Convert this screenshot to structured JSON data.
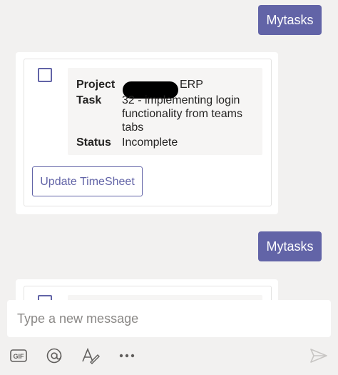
{
  "messages": [
    {
      "bubble": "Mytasks"
    },
    {
      "bubble": "Mytasks"
    }
  ],
  "card": {
    "project_label": "Project",
    "project_value": "ERP",
    "task_label": "Task",
    "task_value": "32 - implementing login functionality from teams tabs",
    "status_label": "Status",
    "status_value": "Incomplete",
    "button_label": "Update TimeSheet"
  },
  "composer": {
    "placeholder": "Type a new message"
  },
  "toolbar": {
    "gif_label": "GIF",
    "icons": [
      "gif-icon",
      "mention-icon",
      "format-icon",
      "more-icon",
      "send-icon"
    ]
  },
  "colors": {
    "accent": "#6264a7",
    "background": "#f2f1f0",
    "card": "#ffffff",
    "fact_bg": "#f6f5f4"
  }
}
